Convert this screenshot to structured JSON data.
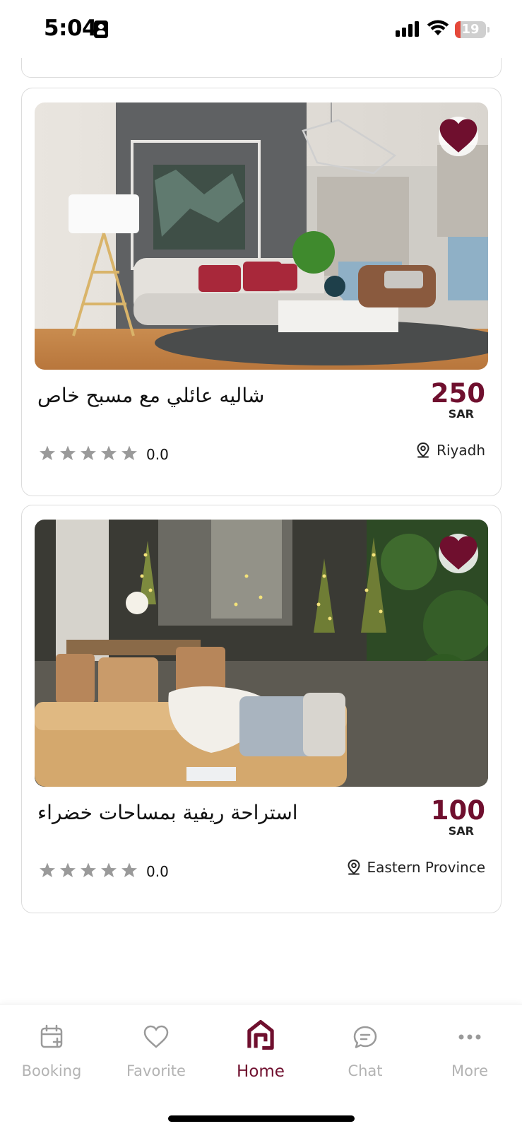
{
  "status_bar": {
    "time": "5:04",
    "battery_level": "19"
  },
  "listings": [
    {
      "title": "شاليه عائلي مع مسبح خاص",
      "price": "250",
      "currency": "SAR",
      "rating": "0.0",
      "stars_filled": 0,
      "stars_total": 5,
      "location": "Riyadh",
      "favorited": true
    },
    {
      "title": "استراحة ريفية بمساحات خضراء",
      "price": "100",
      "currency": "SAR",
      "rating": "0.0",
      "stars_filled": 0,
      "stars_total": 5,
      "location": "Eastern Province",
      "favorited": true
    }
  ],
  "bottom_nav": {
    "items": [
      {
        "label": "Booking",
        "icon": "calendar-plus-icon",
        "active": false
      },
      {
        "label": "Favorite",
        "icon": "heart-outline-icon",
        "active": false
      },
      {
        "label": "Home",
        "icon": "home-icon",
        "active": true
      },
      {
        "label": "Chat",
        "icon": "chat-bubble-icon",
        "active": false
      },
      {
        "label": "More",
        "icon": "more-dots-icon",
        "active": false
      }
    ]
  },
  "colors": {
    "brand": "#6f0f2e",
    "inactive": "#b3b3b3",
    "star_empty": "#9a9a9a",
    "battery_low": "#e5483a"
  }
}
